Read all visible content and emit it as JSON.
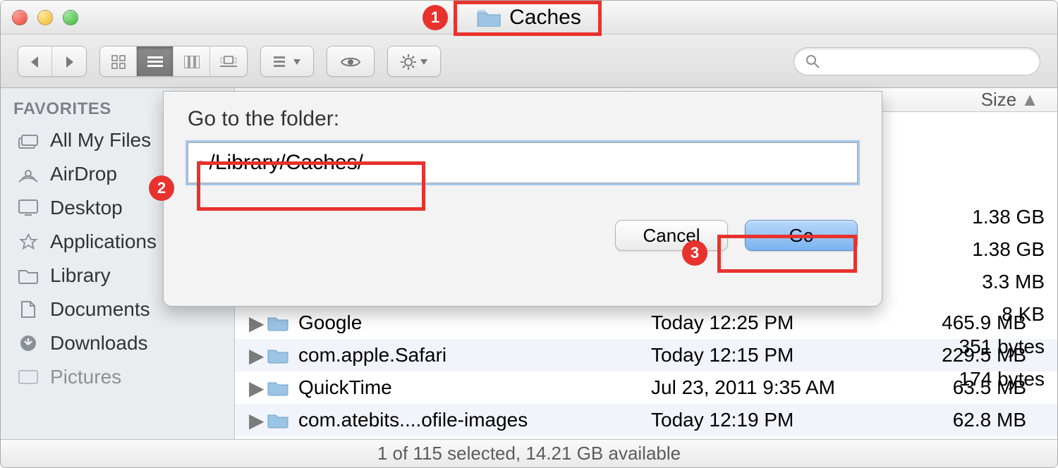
{
  "window": {
    "title": "Caches"
  },
  "toolbar": {
    "search_placeholder": ""
  },
  "sidebar": {
    "heading": "FAVORITES",
    "items": [
      {
        "label": "All My Files",
        "icon": "all-my-files-icon"
      },
      {
        "label": "AirDrop",
        "icon": "airdrop-icon"
      },
      {
        "label": "Desktop",
        "icon": "desktop-icon"
      },
      {
        "label": "Applications",
        "icon": "applications-icon"
      },
      {
        "label": "Library",
        "icon": "folder-icon"
      },
      {
        "label": "Documents",
        "icon": "documents-icon"
      },
      {
        "label": "Downloads",
        "icon": "downloads-icon"
      },
      {
        "label": "Pictures",
        "icon": "pictures-icon"
      }
    ]
  },
  "columns": {
    "size": "Size"
  },
  "rows": [
    {
      "name": "Google",
      "date": "Today 12:25 PM",
      "size": "465.9 MB"
    },
    {
      "name": "com.apple.Safari",
      "date": "Today 12:15 PM",
      "size": "229.5 MB"
    },
    {
      "name": "QuickTime",
      "date": "Jul 23, 2011 9:35 AM",
      "size": "63.5 MB"
    },
    {
      "name": "com.atebits....ofile-images",
      "date": "Today 12:19 PM",
      "size": "62.8 MB"
    }
  ],
  "upper_sizes": [
    "1.38 GB",
    "1.38 GB",
    "3.3 MB",
    "8 KB",
    "351 bytes",
    "174 bytes"
  ],
  "sheet": {
    "label": "Go to the folder:",
    "path": "~/Library/Caches/",
    "cancel": "Cancel",
    "go": "Go"
  },
  "statusbar": "1 of 115 selected, 14.21 GB available",
  "annotations": {
    "1": "1",
    "2": "2",
    "3": "3"
  }
}
